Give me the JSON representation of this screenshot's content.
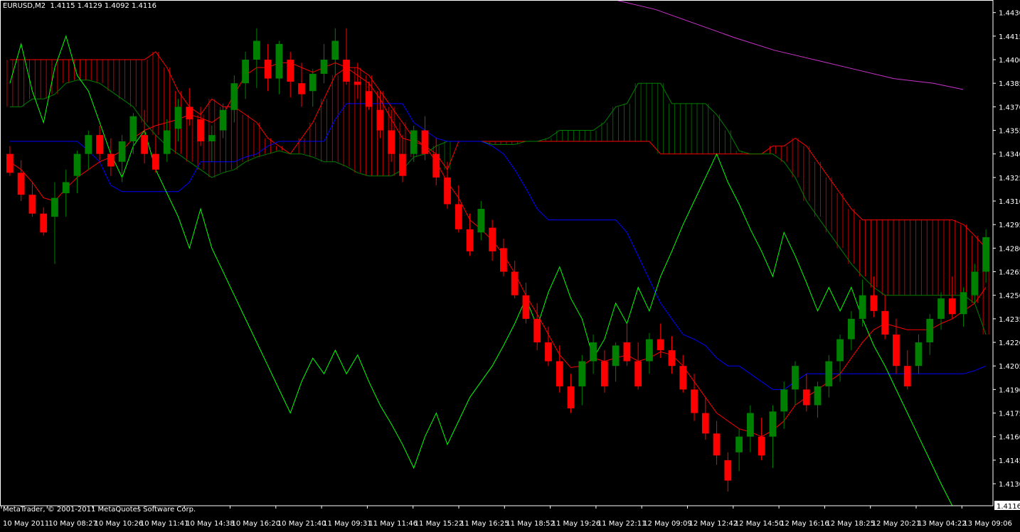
{
  "header": {
    "symbol": "EURUSD,M2",
    "ohlc": "1.4115 1.4129 1.4092 1.4116"
  },
  "footer": {
    "copyright": "MetaTrader, © 2001-2011 MetaQuotes Software Corp."
  },
  "colors": {
    "background": "#000000",
    "frame": "#ffffff",
    "bull_candle": "#008000",
    "bear_candle": "#ff0000",
    "tenkan_sen": "#ff0000",
    "kijun_sen": "#0000ff",
    "senkou_span_a": "#ff0000",
    "senkou_span_b": "#008000",
    "chikou_span": "#00ff00",
    "moving_average": "#cc33cc",
    "price_marker_bg": "#ffffff",
    "price_marker_fg": "#000000"
  },
  "chart_data": {
    "type": "candlestick",
    "ylim": [
      1.4116,
      1.4438
    ],
    "y_ticks": [
      "1.4430",
      "1.4415",
      "1.4400",
      "1.4385",
      "1.4370",
      "1.4355",
      "1.4340",
      "1.4325",
      "1.4310",
      "1.4295",
      "1.4280",
      "1.4265",
      "1.4250",
      "1.4235",
      "1.4220",
      "1.4205",
      "1.4190",
      "1.4175",
      "1.4160",
      "1.4145",
      "1.4130"
    ],
    "current_price": "1.4116",
    "x_ticks": [
      "10 May 2011",
      "10 May 08:27",
      "10 May 10:26",
      "10 May 11:41",
      "10 May 14:38",
      "10 May 16:20",
      "10 May 21:40",
      "11 May 09:31",
      "11 May 11:46",
      "11 May 15:22",
      "11 May 16:25",
      "11 May 18:52",
      "11 May 19:26",
      "11 May 22:11",
      "12 May 09:09",
      "12 May 12:42",
      "12 May 14:50",
      "12 May 16:16",
      "12 May 18:25",
      "12 May 20:21",
      "13 May 04:22",
      "13 May 09:06"
    ],
    "candles": [
      [
        1.434,
        1.4345,
        1.4326,
        1.4328
      ],
      [
        1.4328,
        1.4336,
        1.431,
        1.4314
      ],
      [
        1.4314,
        1.4322,
        1.43,
        1.4302
      ],
      [
        1.4302,
        1.4306,
        1.4288,
        1.429
      ],
      [
        1.43,
        1.4322,
        1.427,
        1.4312
      ],
      [
        1.4315,
        1.433,
        1.43,
        1.4322
      ],
      [
        1.4326,
        1.4342,
        1.4315,
        1.434
      ],
      [
        1.434,
        1.4355,
        1.433,
        1.4352
      ],
      [
        1.4352,
        1.4358,
        1.4336,
        1.434
      ],
      [
        1.434,
        1.435,
        1.4326,
        1.4332
      ],
      [
        1.4335,
        1.4352,
        1.4322,
        1.4348
      ],
      [
        1.4348,
        1.4366,
        1.434,
        1.4364
      ],
      [
        1.4352,
        1.4368,
        1.4334,
        1.434
      ],
      [
        1.434,
        1.4352,
        1.4328,
        1.433
      ],
      [
        1.434,
        1.4362,
        1.4335,
        1.4355
      ],
      [
        1.4356,
        1.4375,
        1.4348,
        1.437
      ],
      [
        1.437,
        1.4382,
        1.4358,
        1.4362
      ],
      [
        1.4362,
        1.437,
        1.4345,
        1.4348
      ],
      [
        1.4348,
        1.4358,
        1.4335,
        1.4352
      ],
      [
        1.4355,
        1.4372,
        1.435,
        1.4368
      ],
      [
        1.4368,
        1.439,
        1.436,
        1.4385
      ],
      [
        1.4385,
        1.4405,
        1.4375,
        1.44
      ],
      [
        1.44,
        1.442,
        1.4382,
        1.4412
      ],
      [
        1.44,
        1.441,
        1.438,
        1.4388
      ],
      [
        1.4388,
        1.4412,
        1.4378,
        1.441
      ],
      [
        1.44,
        1.4405,
        1.4376,
        1.4386
      ],
      [
        1.4385,
        1.4398,
        1.437,
        1.4378
      ],
      [
        1.438,
        1.4394,
        1.437,
        1.4391
      ],
      [
        1.4391,
        1.441,
        1.4385,
        1.44
      ],
      [
        1.44,
        1.442,
        1.439,
        1.4412
      ],
      [
        1.44,
        1.442,
        1.4384,
        1.4386
      ],
      [
        1.4386,
        1.4398,
        1.4375,
        1.4384
      ],
      [
        1.438,
        1.4386,
        1.4368,
        1.437
      ],
      [
        1.4368,
        1.438,
        1.435,
        1.4355
      ],
      [
        1.4355,
        1.4368,
        1.4335,
        1.434
      ],
      [
        1.434,
        1.4352,
        1.4322,
        1.4326
      ],
      [
        1.434,
        1.4358,
        1.4335,
        1.4355
      ],
      [
        1.4355,
        1.4364,
        1.4336,
        1.434
      ],
      [
        1.434,
        1.435,
        1.432,
        1.4325
      ],
      [
        1.4325,
        1.4335,
        1.4305,
        1.4308
      ],
      [
        1.4308,
        1.432,
        1.429,
        1.4292
      ],
      [
        1.4292,
        1.4302,
        1.4275,
        1.4278
      ],
      [
        1.429,
        1.431,
        1.4285,
        1.4305
      ],
      [
        1.4293,
        1.4298,
        1.4272,
        1.4278
      ],
      [
        1.428,
        1.4286,
        1.4262,
        1.4265
      ],
      [
        1.4265,
        1.4272,
        1.4248,
        1.425
      ],
      [
        1.425,
        1.4258,
        1.4232,
        1.4235
      ],
      [
        1.4235,
        1.4245,
        1.4215,
        1.422
      ],
      [
        1.422,
        1.423,
        1.4205,
        1.4208
      ],
      [
        1.4208,
        1.4218,
        1.4188,
        1.4192
      ],
      [
        1.4192,
        1.42,
        1.4175,
        1.4178
      ],
      [
        1.4192,
        1.4212,
        1.418,
        1.4208
      ],
      [
        1.4208,
        1.4225,
        1.42,
        1.422
      ],
      [
        1.4208,
        1.4215,
        1.4188,
        1.4192
      ],
      [
        1.4205,
        1.422,
        1.4195,
        1.4218
      ],
      [
        1.422,
        1.4232,
        1.4205,
        1.4208
      ],
      [
        1.4208,
        1.422,
        1.419,
        1.4192
      ],
      [
        1.4208,
        1.4226,
        1.42,
        1.4222
      ],
      [
        1.4222,
        1.4232,
        1.421,
        1.4215
      ],
      [
        1.4215,
        1.4224,
        1.42,
        1.4205
      ],
      [
        1.4205,
        1.4212,
        1.4188,
        1.419
      ],
      [
        1.419,
        1.42,
        1.417,
        1.4175
      ],
      [
        1.4175,
        1.4185,
        1.4158,
        1.4162
      ],
      [
        1.4162,
        1.417,
        1.4142,
        1.4148
      ],
      [
        1.4145,
        1.415,
        1.4125,
        1.4132
      ],
      [
        1.415,
        1.4165,
        1.4138,
        1.416
      ],
      [
        1.416,
        1.418,
        1.415,
        1.4175
      ],
      [
        1.416,
        1.4172,
        1.4145,
        1.4148
      ],
      [
        1.416,
        1.418,
        1.414,
        1.4176
      ],
      [
        1.4176,
        1.4195,
        1.4165,
        1.419
      ],
      [
        1.419,
        1.4208,
        1.418,
        1.4205
      ],
      [
        1.419,
        1.42,
        1.4176,
        1.418
      ],
      [
        1.418,
        1.4195,
        1.4172,
        1.4192
      ],
      [
        1.4192,
        1.4212,
        1.4185,
        1.4208
      ],
      [
        1.4208,
        1.4225,
        1.4195,
        1.4222
      ],
      [
        1.4222,
        1.424,
        1.4215,
        1.4235
      ],
      [
        1.4235,
        1.426,
        1.423,
        1.425
      ],
      [
        1.425,
        1.4262,
        1.4236,
        1.424
      ],
      [
        1.424,
        1.425,
        1.4222,
        1.4225
      ],
      [
        1.4225,
        1.4235,
        1.42,
        1.4205
      ],
      [
        1.4205,
        1.4215,
        1.419,
        1.4192
      ],
      [
        1.4205,
        1.4225,
        1.42,
        1.422
      ],
      [
        1.422,
        1.4238,
        1.4212,
        1.4235
      ],
      [
        1.4235,
        1.4252,
        1.4228,
        1.4248
      ],
      [
        1.4248,
        1.4262,
        1.4235,
        1.4238
      ],
      [
        1.4238,
        1.4255,
        1.423,
        1.4252
      ],
      [
        1.425,
        1.427,
        1.4245,
        1.4265
      ],
      [
        1.4265,
        1.4292,
        1.4258,
        1.4287
      ]
    ],
    "tenkan_sen": [
      1.4335,
      1.433,
      1.4322,
      1.4312,
      1.431,
      1.4318,
      1.4325,
      1.433,
      1.4335,
      1.4338,
      1.4342,
      1.435,
      1.4355,
      1.4358,
      1.436,
      1.4362,
      1.4365,
      1.4363,
      1.436,
      1.4365,
      1.4378,
      1.439,
      1.4395,
      1.4395,
      1.4398,
      1.4398,
      1.4395,
      1.4392,
      1.4395,
      1.4398,
      1.4395,
      1.439,
      1.4385,
      1.4375,
      1.4362,
      1.435,
      1.4348,
      1.4345,
      1.4335,
      1.4322,
      1.4312,
      1.4298,
      1.4292,
      1.4285,
      1.4276,
      1.4264,
      1.425,
      1.4238,
      1.4225,
      1.4212,
      1.4204,
      1.4205,
      1.421,
      1.4208,
      1.421,
      1.4212,
      1.4208,
      1.421,
      1.4214,
      1.4212,
      1.4205,
      1.4195,
      1.4185,
      1.4175,
      1.417,
      1.4165,
      1.4163,
      1.416,
      1.4164,
      1.417,
      1.418,
      1.4185,
      1.419,
      1.4195,
      1.42,
      1.421,
      1.422,
      1.4228,
      1.4232,
      1.423,
      1.4228,
      1.4228,
      1.4228,
      1.4232,
      1.4235,
      1.424,
      1.4245,
      1.4255
    ],
    "kijun_sen": [
      1.4348,
      1.4348,
      1.4348,
      1.4348,
      1.4348,
      1.4348,
      1.4348,
      1.4342,
      1.4335,
      1.432,
      1.4316,
      1.4316,
      1.4316,
      1.4316,
      1.4316,
      1.4316,
      1.4322,
      1.4335,
      1.4335,
      1.4335,
      1.4335,
      1.4338,
      1.434,
      1.4345,
      1.4348,
      1.4348,
      1.4348,
      1.4348,
      1.4348,
      1.4362,
      1.4372,
      1.4372,
      1.4372,
      1.4372,
      1.4372,
      1.4372,
      1.436,
      1.4355,
      1.435,
      1.4348,
      1.4348,
      1.4348,
      1.4348,
      1.4345,
      1.434,
      1.433,
      1.4318,
      1.4305,
      1.4298,
      1.4298,
      1.4298,
      1.4298,
      1.4298,
      1.4298,
      1.4298,
      1.429,
      1.4275,
      1.426,
      1.4245,
      1.4235,
      1.4225,
      1.4222,
      1.4218,
      1.421,
      1.4205,
      1.4205,
      1.42,
      1.4195,
      1.419,
      1.419,
      1.4195,
      1.42,
      1.42,
      1.42,
      1.42,
      1.42,
      1.42,
      1.42,
      1.42,
      1.42,
      1.42,
      1.42,
      1.42,
      1.42,
      1.42,
      1.42,
      1.4202,
      1.4205
    ],
    "senkou_span_a": [
      1.44,
      1.44,
      1.44,
      1.44,
      1.44,
      1.44,
      1.44,
      1.44,
      1.44,
      1.44,
      1.44,
      1.44,
      1.44,
      1.4405,
      1.4395,
      1.438,
      1.437,
      1.4365,
      1.4375,
      1.437,
      1.437,
      1.4365,
      1.436,
      1.435,
      1.4345,
      1.434,
      1.435,
      1.436,
      1.4375,
      1.439,
      1.4395,
      1.4395,
      1.439,
      1.438,
      1.437,
      1.436,
      1.435,
      1.4345,
      1.434,
      1.433,
      1.4348,
      1.4348,
      1.4348,
      1.4348,
      1.4348,
      1.4348,
      1.4348,
      1.4348,
      1.4348,
      1.4348,
      1.4348,
      1.4348,
      1.4348,
      1.4348,
      1.4348,
      1.4348,
      1.4348,
      1.4348,
      1.434,
      1.434,
      1.434,
      1.434,
      1.434,
      1.434,
      1.434,
      1.434,
      1.434,
      1.434,
      1.4345,
      1.4345,
      1.435,
      1.4345,
      1.4335,
      1.4325,
      1.4315,
      1.4305,
      1.4298,
      1.4298,
      1.4298,
      1.4298,
      1.4298,
      1.4298,
      1.4298,
      1.4298,
      1.4298,
      1.4295,
      1.4288,
      1.428
    ],
    "senkou_span_b": [
      1.437,
      1.437,
      1.4375,
      1.4375,
      1.4378,
      1.4385,
      1.4387,
      1.4387,
      1.4385,
      1.438,
      1.4375,
      1.437,
      1.436,
      1.4352,
      1.4345,
      1.434,
      1.4335,
      1.433,
      1.4325,
      1.4328,
      1.433,
      1.4335,
      1.4338,
      1.434,
      1.4342,
      1.434,
      1.434,
      1.4338,
      1.4335,
      1.4335,
      1.4332,
      1.4328,
      1.4326,
      1.4326,
      1.4326,
      1.433,
      1.4338,
      1.434,
      1.4345,
      1.4348,
      1.4348,
      1.4348,
      1.4348,
      1.4346,
      1.4346,
      1.4346,
      1.4348,
      1.4348,
      1.435,
      1.4355,
      1.4355,
      1.4355,
      1.4355,
      1.436,
      1.437,
      1.4372,
      1.4385,
      1.4385,
      1.4385,
      1.4372,
      1.4372,
      1.4372,
      1.4372,
      1.4365,
      1.4355,
      1.4342,
      1.434,
      1.434,
      1.434,
      1.4335,
      1.4325,
      1.431,
      1.43,
      1.429,
      1.428,
      1.427,
      1.4262,
      1.4255,
      1.425,
      1.425,
      1.425,
      1.425,
      1.425,
      1.425,
      1.425,
      1.425,
      1.4245,
      1.4225
    ],
    "chikou_span": [
      1.4385,
      1.441,
      1.438,
      1.436,
      1.4395,
      1.4415,
      1.439,
      1.438,
      1.436,
      1.434,
      1.4325,
      1.4345,
      1.4355,
      1.433,
      1.4315,
      1.43,
      1.428,
      1.4305,
      1.428,
      1.4265,
      1.425,
      1.4235,
      1.422,
      1.4205,
      1.419,
      1.4175,
      1.4195,
      1.421,
      1.42,
      1.4215,
      1.42,
      1.4212,
      1.4195,
      1.418,
      1.4168,
      1.4155,
      1.414,
      1.416,
      1.4175,
      1.4155,
      1.417,
      1.4185,
      1.4195,
      1.4205,
      1.4218,
      1.4232,
      1.4248,
      1.423,
      1.4252,
      1.4268,
      1.4248,
      1.4235,
      1.421,
      1.4222,
      1.4245,
      1.4232,
      1.4255,
      1.424,
      1.4262,
      1.4278,
      1.4295,
      1.431,
      1.4325,
      1.434,
      1.4322,
      1.4308,
      1.4292,
      1.4278,
      1.4262,
      1.429,
      1.4275,
      1.4258,
      1.424,
      1.4255,
      1.424,
      1.4255,
      1.4235,
      1.4218,
      1.4205,
      1.419,
      1.4175,
      1.416,
      1.4145,
      1.413,
      1.4116
    ],
    "moving_average": [
      [
        0.62,
        1.4438
      ],
      [
        0.66,
        1.4432
      ],
      [
        0.7,
        1.4423
      ],
      [
        0.74,
        1.4414
      ],
      [
        0.78,
        1.4406
      ],
      [
        0.82,
        1.44
      ],
      [
        0.86,
        1.4394
      ],
      [
        0.9,
        1.4388
      ],
      [
        0.94,
        1.4385
      ],
      [
        0.97,
        1.4381
      ]
    ]
  }
}
